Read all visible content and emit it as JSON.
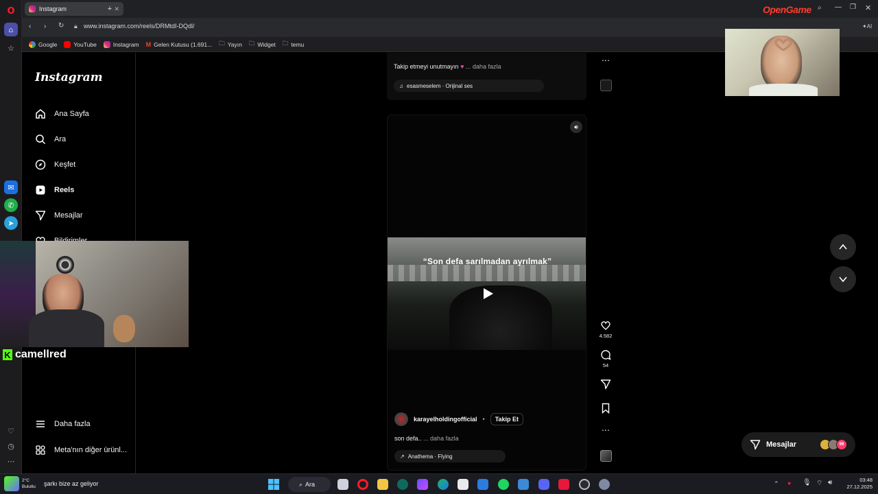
{
  "browser": {
    "tab_title": "Instagram",
    "url": "www.instagram.com/reels/DRMtdI-DQdl/",
    "bookmarks": [
      "Google",
      "YouTube",
      "Instagram",
      "Gelen Kutusu (1.691...",
      "Yayın",
      "Widget",
      "temu"
    ],
    "overlay_brand": "OpenGame"
  },
  "nav": {
    "logo": "Instagram",
    "items": [
      {
        "label": "Ana Sayfa",
        "icon": "home-icon"
      },
      {
        "label": "Ara",
        "icon": "search-icon"
      },
      {
        "label": "Keşfet",
        "icon": "explore-icon"
      },
      {
        "label": "Reels",
        "icon": "reels-icon"
      },
      {
        "label": "Mesajlar",
        "icon": "messages-icon"
      },
      {
        "label": "Bildirimler",
        "icon": "heart-icon"
      }
    ],
    "more_label": "Daha fazla",
    "meta_label": "Meta'nın diğer ürünl..."
  },
  "previous_reel": {
    "caption": "Takip etmeyi unutmayın",
    "more": "... daha fazla",
    "audio": "esasmeselem · Orijinal ses"
  },
  "reel": {
    "overlay_text": "“Son defa sarılmadan ayrılmak”",
    "username": "karayelholdingofficial",
    "follow_label": "Takip Et",
    "caption": "son defa..",
    "more": "... daha fazla",
    "audio": "Anathema · Flying",
    "likes": "4.582",
    "comments": "54"
  },
  "messages_pill": {
    "label": "Mesajlar"
  },
  "streamer": {
    "name": "camellred"
  },
  "taskbar": {
    "weather_temp": "2°C",
    "weather_label": "Bulutlu",
    "now_playing": "şarkı bize az geliyor",
    "search_label": "Ara",
    "time": "03:48",
    "date": "27.12.2025"
  },
  "colors": {
    "accent_like": "#ff3040",
    "ig_bg": "#000000",
    "pill_bg": "#1c1c1c"
  }
}
